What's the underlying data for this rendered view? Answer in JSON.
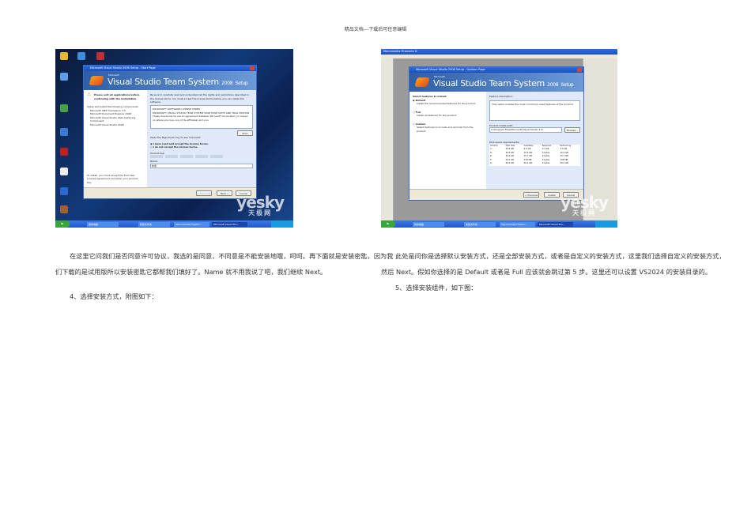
{
  "header": "精品文档---下载后可任意编辑",
  "left_screenshot": {
    "window_title": "Microsoft Visual Studio 2008 Setup - Start Page",
    "banner_small": "Microsoft",
    "banner_title": "Visual Studio Team System",
    "banner_year": "2008",
    "banner_setup": "Setup",
    "warning": "Please exit all applications before continuing with the installation.",
    "components_intro": "Setup will install the following components:",
    "components": [
      "Microsoft .NET Framework 3.5",
      "Microsoft Document Explorer 2008",
      "Microsoft Visual Studio Web Authoring Component",
      "Microsoft Visual Studio 2008"
    ],
    "accept_note": "To install, you must accept the End User License Agreement and enter your product key.",
    "license_intro": "Be sure to carefully read and understand all the rights and restrictions described in the license terms. You must accept the license terms before you can install the software.",
    "license_text": [
      "MICROSOFT SOFTWARE LICENSE TERMS",
      "MICROSOFT VISUAL STUDIO TEAM SYSTEM 2008 TEAM SUITE AND TRIAL EDITION",
      "These license terms are an agreement between Microsoft Corporation (or based on where you live, one of its affiliates) and you."
    ],
    "print": "Print",
    "page_down_note": "Press the Page Down key to see more text.",
    "accept": "I have read and accept the license terms.",
    "decline": "I do not accept the license terms.",
    "product_key_label": "Product key:",
    "name_label": "Name:",
    "name_value": "新用",
    "buttons": {
      "previous": "< Previous",
      "next": "Next >",
      "cancel": "Cancel"
    },
    "taskbar": [
      "我的电脑",
      "新建文件夹",
      "Macromedia Firewor...",
      "Microsoft Visual Stu..."
    ],
    "watermark": "yesky",
    "watermark_cn": "天极网"
  },
  "right_screenshot": {
    "app_title": "Macromedia Fireworks 8",
    "window_title": "Microsoft Visual Studio 2008 Setup - Options Page",
    "banner_small": "Microsoft",
    "banner_title": "Visual Studio Team System",
    "banner_year": "2008",
    "banner_setup": "Setup",
    "select_label": "Select features to install:",
    "options": [
      {
        "label": "Default",
        "desc": "Install the recommended features for the product"
      },
      {
        "label": "Full",
        "desc": "Install all features for the product"
      },
      {
        "label": "Custom",
        "desc": "Select features to include and exclude from the product"
      }
    ],
    "feature_desc_label": "Feature description:",
    "feature_desc": "This option installs the most commonly used features of the product.",
    "install_path_label": "Product install path:",
    "install_path": "C:\\Program Files\\Microsoft Visual Studio 9.0\\",
    "browse": "Browse...",
    "disk_label": "Disk space requirements:",
    "disk_headers": [
      "Volume",
      "Disk Size",
      "Available",
      "Required",
      "Remaining"
    ],
    "disk_rows": [
      [
        "C:",
        "29.9 GB",
        "6.9 GB",
        "3.4 GB",
        "3.5 GB"
      ],
      [
        "D:",
        "29.9 GB",
        "10.6 GB",
        "0 bytes",
        "10.6 GB"
      ],
      [
        "E:",
        "39.0 GB",
        "15.7 GB",
        "0 bytes",
        "15.7 GB"
      ],
      [
        "F:",
        "40.0 GB",
        "338 MB",
        "0 bytes",
        "338 MB"
      ],
      [
        "G:",
        "60.0 GB",
        "56.4 GB",
        "0 bytes",
        "56.4 GB"
      ]
    ],
    "buttons": {
      "previous": "< Previous",
      "install": "Install",
      "cancel": "Cancel"
    },
    "taskbar": [
      "我的电脑",
      "新建文件夹",
      "Macromedia Firewor...",
      "Microsoft Visual Stu..."
    ],
    "watermark": "yesky",
    "watermark_cn": "天极网"
  },
  "left_text": {
    "lines": [
      "在这里它问我们是否同意许可协议，我选的是同意，不同意是不能安装地哦，呵呵。再下面就是安装密匙，因为我",
      "们下载的是试用版所以安装密匙它都帮我们填好了。Name 就不用我说了吧，我们继续 Next。"
    ],
    "step": "4、选择安装方式，附图如下："
  },
  "right_text": {
    "lines": [
      "此处是问你是选择默认安装方式，还是全部安装方式，或者是自定义的安装方式，这里我们选择自定义的安装方式，",
      "然后 Next。假如你选择的是 Default 或者是 Full 应该就会跳过第 5 步。这里还可以设置 VS2024 的安装目录的。"
    ],
    "step": "5、选择安装组件，如下图："
  }
}
